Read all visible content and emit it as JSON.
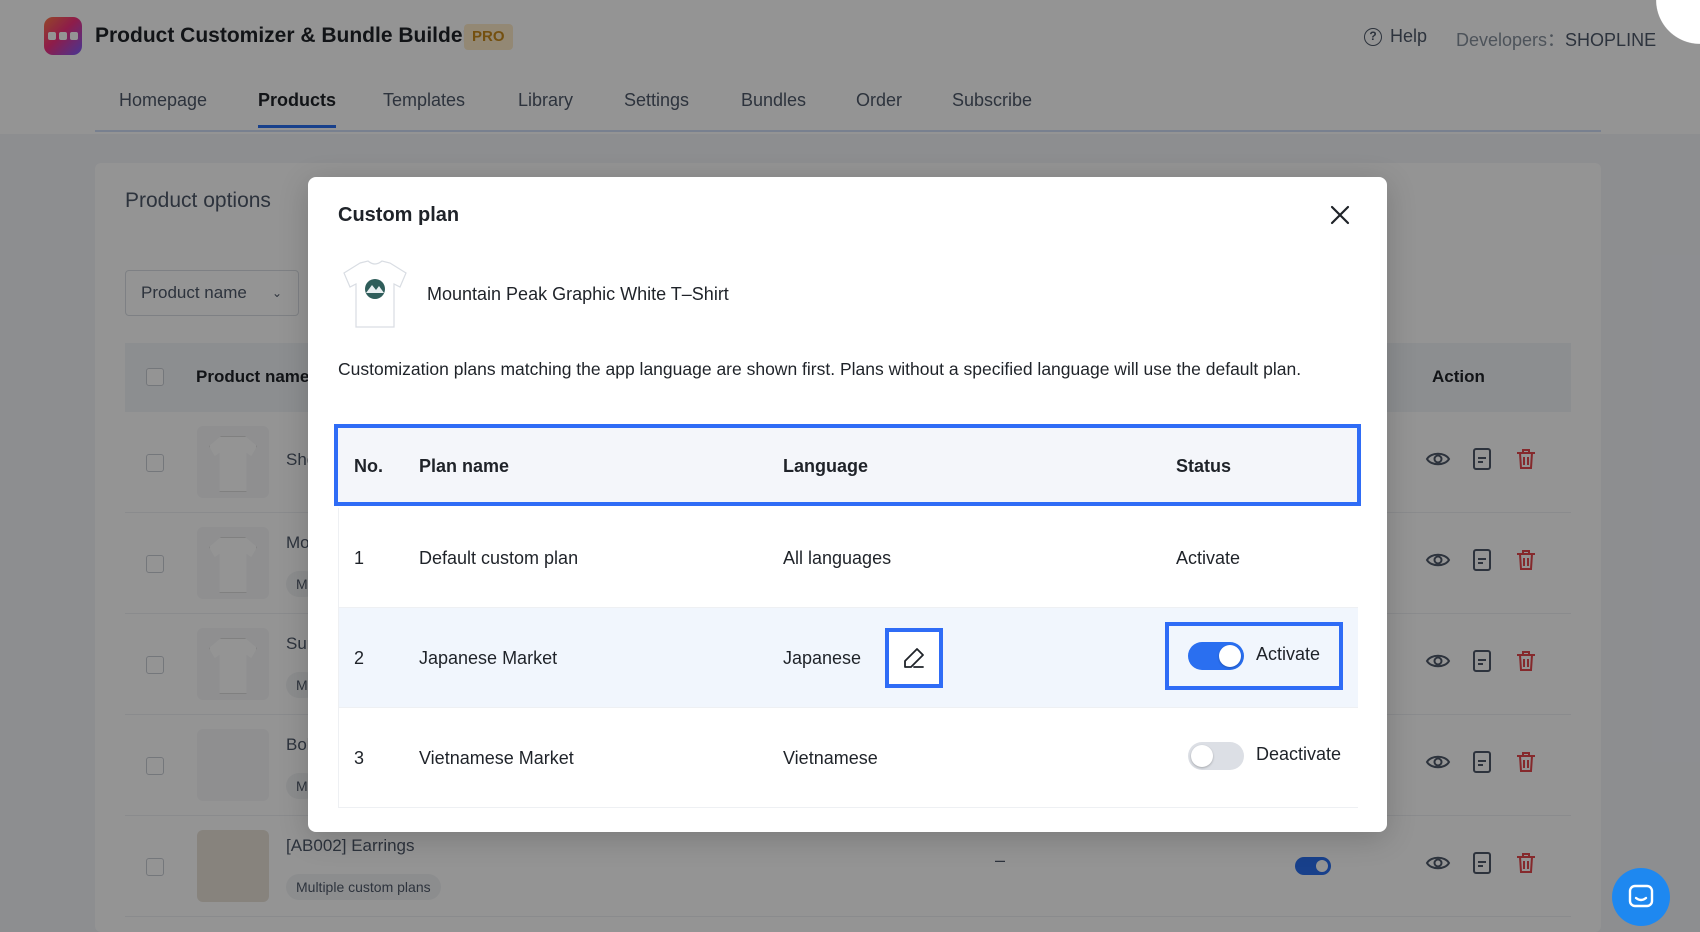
{
  "app": {
    "title": "Product Customizer & Bundle Builder",
    "badge": "PRO",
    "help_label": "Help",
    "developers_label": "Developers：",
    "developers_name": "SHOPLINE"
  },
  "nav": {
    "tabs": [
      {
        "label": "Homepage"
      },
      {
        "label": "Products",
        "active": true
      },
      {
        "label": "Templates"
      },
      {
        "label": "Library"
      },
      {
        "label": "Settings"
      },
      {
        "label": "Bundles"
      },
      {
        "label": "Order"
      },
      {
        "label": "Subscribe"
      }
    ]
  },
  "product_options": {
    "title": "Product options",
    "filter_label": "Product name",
    "columns": {
      "name": "Product name",
      "action": "Action"
    },
    "rows": [
      {
        "name": "Sho",
        "tag": ""
      },
      {
        "name": "Mo",
        "tag": "M"
      },
      {
        "name": "Sur",
        "tag": "M"
      },
      {
        "name": "Boh",
        "tag": "M"
      },
      {
        "name": "[AB002] Earrings",
        "tag": "Multiple custom plans",
        "dash": "–"
      }
    ]
  },
  "modal": {
    "title": "Custom plan",
    "product_name": "Mountain Peak Graphic White T–Shirt",
    "note": "Customization plans matching the app language are shown first. Plans without a specified language will use the default plan.",
    "columns": {
      "no": "No.",
      "plan_name": "Plan name",
      "language": "Language",
      "status": "Status"
    },
    "plans": [
      {
        "no": "1",
        "name": "Default custom plan",
        "language": "All languages",
        "status": "Activate",
        "toggle": null
      },
      {
        "no": "2",
        "name": "Japanese Market",
        "language": "Japanese",
        "status": "Activate",
        "toggle": "on"
      },
      {
        "no": "3",
        "name": "Vietnamese Market",
        "language": "Vietnamese",
        "status": "Deactivate",
        "toggle": "off"
      }
    ]
  },
  "colors": {
    "accent": "#2a6ff0",
    "highlight_outline": "#2f6cf6",
    "delete": "#e5484d"
  },
  "icons": [
    "close-icon",
    "edit-icon",
    "eye-icon",
    "document-icon",
    "trash-icon",
    "help-icon",
    "chevron-down-icon",
    "chat-icon"
  ]
}
